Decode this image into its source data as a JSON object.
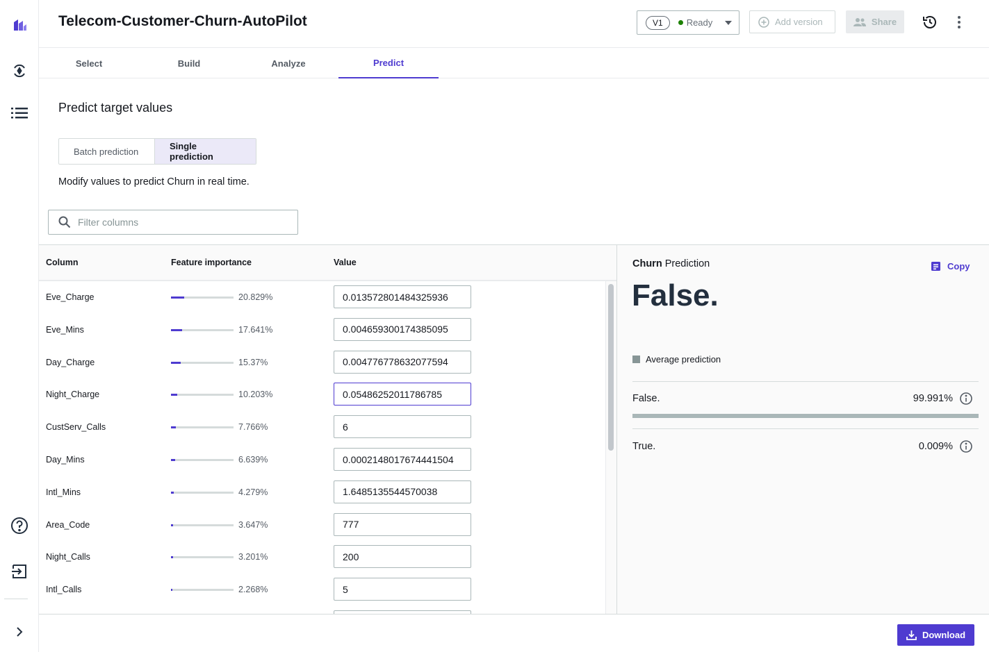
{
  "header": {
    "title": "Telecom-Customer-Churn-AutoPilot",
    "version": "V1",
    "status": "Ready",
    "add_version": "Add version",
    "share": "Share"
  },
  "tabs": [
    "Select",
    "Build",
    "Analyze",
    "Predict"
  ],
  "active_tab": "Predict",
  "page": {
    "heading": "Predict target values",
    "segments": [
      "Batch prediction",
      "Single prediction"
    ],
    "hint": "Modify values to predict Churn in real time.",
    "filter_placeholder": "Filter columns"
  },
  "table": {
    "headers": [
      "Column",
      "Feature importance",
      "Value"
    ],
    "rows": [
      {
        "column": "Eve_Charge",
        "importance": "20.829%",
        "importance_value": 20.829,
        "value": "0.013572801484325936"
      },
      {
        "column": "Eve_Mins",
        "importance": "17.641%",
        "importance_value": 17.641,
        "value": "0.004659300174385095"
      },
      {
        "column": "Day_Charge",
        "importance": "15.37%",
        "importance_value": 15.37,
        "value": "0.004776778632077594"
      },
      {
        "column": "Night_Charge",
        "importance": "10.203%",
        "importance_value": 10.203,
        "value": "0.05486252011786785"
      },
      {
        "column": "CustServ_Calls",
        "importance": "7.766%",
        "importance_value": 7.766,
        "value": "6"
      },
      {
        "column": "Day_Mins",
        "importance": "6.639%",
        "importance_value": 6.639,
        "value": "0.0002148017674441504"
      },
      {
        "column": "Intl_Mins",
        "importance": "4.279%",
        "importance_value": 4.279,
        "value": "1.6485135544570038"
      },
      {
        "column": "Area_Code",
        "importance": "3.647%",
        "importance_value": 3.647,
        "value": "777"
      },
      {
        "column": "Night_Calls",
        "importance": "3.201%",
        "importance_value": 3.201,
        "value": "200"
      },
      {
        "column": "Intl_Calls",
        "importance": "2.268%",
        "importance_value": 2.268,
        "value": "5"
      }
    ]
  },
  "prediction": {
    "target": "Churn",
    "label": "Prediction",
    "copy": "Copy",
    "result": "False.",
    "legend": "Average prediction",
    "classes": [
      {
        "label": "False.",
        "value": "99.991%",
        "fraction": 0.99991
      },
      {
        "label": "True.",
        "value": "0.009%",
        "fraction": 9e-05
      }
    ]
  },
  "footer": {
    "download": "Download"
  },
  "colors": {
    "accent": "#4e3bd0",
    "ready": "#1d8102"
  }
}
